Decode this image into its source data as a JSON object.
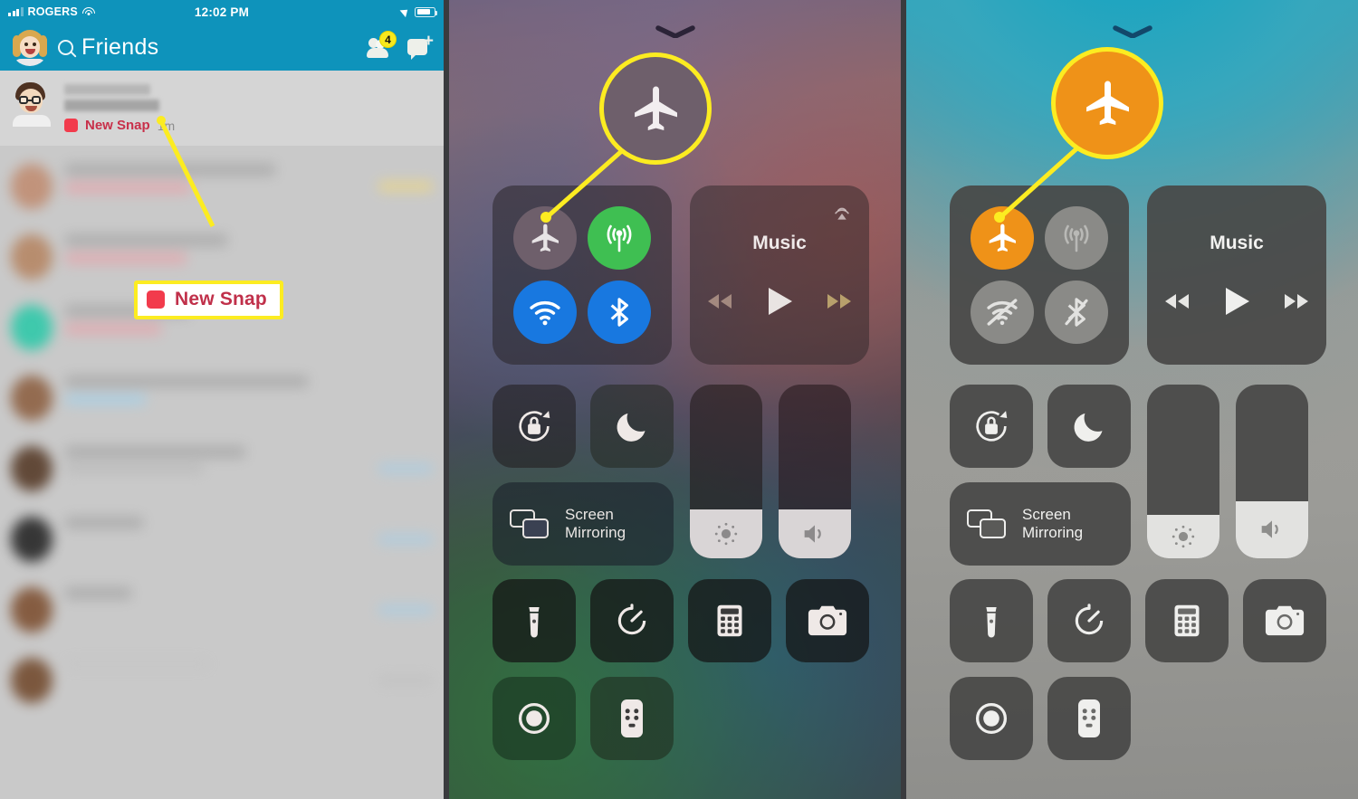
{
  "snapchat": {
    "status_bar": {
      "carrier": "ROGERS",
      "time": "12:02 PM",
      "signal_icon": "cellular-signal-icon",
      "wifi_icon": "wifi-icon",
      "location_icon": "location-arrow-icon",
      "battery_icon": "battery-icon"
    },
    "nav": {
      "avatar_icon": "bitmoji-avatar",
      "search_icon": "search-icon",
      "title": "Friends",
      "friends_icon": "add-friends-icon",
      "friends_badge": "4",
      "new_chat_icon": "new-chat-icon"
    },
    "first_row": {
      "avatar_icon": "bitmoji-avatar",
      "status_square_icon": "new-snap-square-icon",
      "status_label": "New Snap",
      "timestamp": "1m"
    },
    "callout": {
      "square_icon": "new-snap-square-icon",
      "label": "New Snap"
    }
  },
  "control_center_before": {
    "chevron_icon": "chevron-down-icon",
    "connectivity": {
      "airplane": {
        "icon": "airplane-icon",
        "label": "Airplane Mode",
        "state": "off",
        "color": "#6e5f6b"
      },
      "cellular": {
        "icon": "cellular-data-icon",
        "label": "Cellular Data",
        "state": "on",
        "color": "#3fbf52"
      },
      "wifi": {
        "icon": "wifi-icon",
        "label": "Wi-Fi",
        "state": "on",
        "color": "#1878e0"
      },
      "bluetooth": {
        "icon": "bluetooth-icon",
        "label": "Bluetooth",
        "state": "on",
        "color": "#1878e0"
      }
    },
    "music": {
      "title": "Music",
      "airplay_icon": "airplay-icon",
      "rewind_icon": "rewind-icon",
      "play_icon": "play-icon",
      "forward_icon": "fast-forward-icon"
    },
    "controls": {
      "rotation_lock_icon": "rotation-lock-icon",
      "do_not_disturb_icon": "moon-icon",
      "screen_mirroring_icon": "screen-mirroring-icon",
      "screen_mirroring_label_line1": "Screen",
      "screen_mirroring_label_line2": "Mirroring",
      "brightness_icon": "brightness-icon",
      "brightness_level": 28,
      "volume_icon": "volume-icon",
      "volume_level": 28
    },
    "shortcuts": {
      "flashlight_icon": "flashlight-icon",
      "timer_icon": "timer-icon",
      "calculator_icon": "calculator-icon",
      "camera_icon": "camera-icon",
      "screen_record_icon": "screen-record-icon",
      "apple_tv_remote_icon": "apple-tv-remote-icon"
    },
    "highlight": {
      "icon": "airplane-icon",
      "ring_color": "#fcec21",
      "fill_color": "#6e5f6b"
    }
  },
  "control_center_after": {
    "chevron_icon": "chevron-down-icon",
    "connectivity": {
      "airplane": {
        "icon": "airplane-icon",
        "label": "Airplane Mode",
        "state": "on",
        "color": "#ef9218"
      },
      "cellular": {
        "icon": "cellular-data-icon",
        "label": "Cellular Data",
        "state": "off",
        "color": "#7b7b78"
      },
      "wifi": {
        "icon": "wifi-off-icon",
        "label": "Wi-Fi",
        "state": "off",
        "color": "#7b7b78"
      },
      "bluetooth": {
        "icon": "bluetooth-off-icon",
        "label": "Bluetooth",
        "state": "off",
        "color": "#7b7b78"
      }
    },
    "music": {
      "title": "Music",
      "rewind_icon": "rewind-icon",
      "play_icon": "play-icon",
      "forward_icon": "fast-forward-icon"
    },
    "controls": {
      "rotation_lock_icon": "rotation-lock-icon",
      "do_not_disturb_icon": "moon-icon",
      "screen_mirroring_icon": "screen-mirroring-icon",
      "screen_mirroring_label_line1": "Screen",
      "screen_mirroring_label_line2": "Mirroring",
      "brightness_icon": "brightness-icon",
      "brightness_level": 25,
      "volume_icon": "volume-icon",
      "volume_level": 33
    },
    "shortcuts": {
      "flashlight_icon": "flashlight-icon",
      "timer_icon": "timer-icon",
      "calculator_icon": "calculator-icon",
      "camera_icon": "camera-icon",
      "screen_record_icon": "screen-record-icon",
      "apple_tv_remote_icon": "apple-tv-remote-icon"
    },
    "highlight": {
      "icon": "airplane-icon",
      "ring_color": "#fcec21",
      "fill_color": "#ef9218"
    }
  }
}
